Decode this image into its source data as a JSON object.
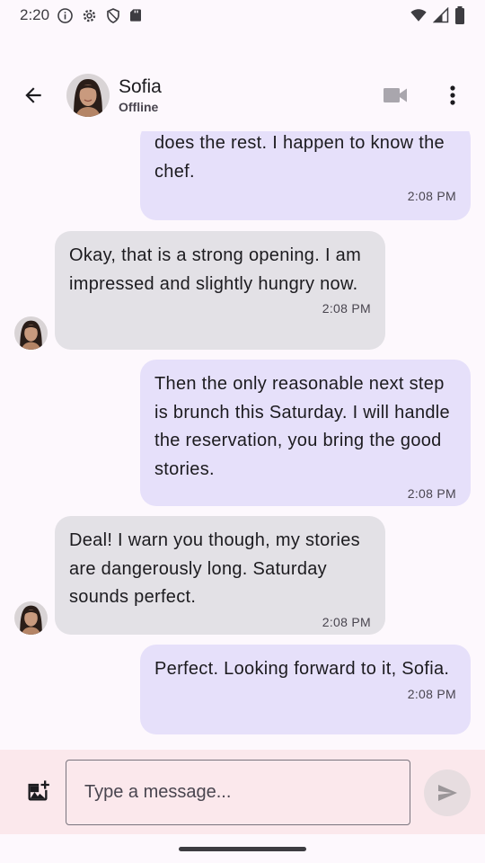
{
  "status_bar": {
    "time": "2:20"
  },
  "header": {
    "contact_name": "Sofia",
    "contact_status": "Offline",
    "icons": [
      "back-arrow-icon",
      "video-camera-icon",
      "more-vert-icon"
    ]
  },
  "messages": [
    {
      "direction": "sent",
      "text": "does the rest. I happen to know the chef.",
      "time": "2:08 PM"
    },
    {
      "direction": "received",
      "text": "Okay, that is a strong opening. I am impressed and slightly hungry now.",
      "time": "2:08 PM"
    },
    {
      "direction": "sent",
      "text": "Then the only reasonable next step is brunch this Saturday. I will handle the reservation, you bring the good stories.",
      "time": "2:08 PM"
    },
    {
      "direction": "received",
      "text": "Deal! I warn you though, my stories are dangerously long. Saturday sounds perfect.",
      "time": "2:08 PM"
    },
    {
      "direction": "sent",
      "text": "Perfect. Looking forward to it, Sofia.",
      "time": "2:08 PM"
    }
  ],
  "composer": {
    "placeholder": "Type a message...",
    "icons": [
      "add-photo-icon",
      "send-icon"
    ]
  },
  "colors": {
    "sent_bubble": "#e6e0fa",
    "received_bubble": "#e3e1e6",
    "composer_bg": "#fbe8ec",
    "background": "#fdf8fd"
  }
}
